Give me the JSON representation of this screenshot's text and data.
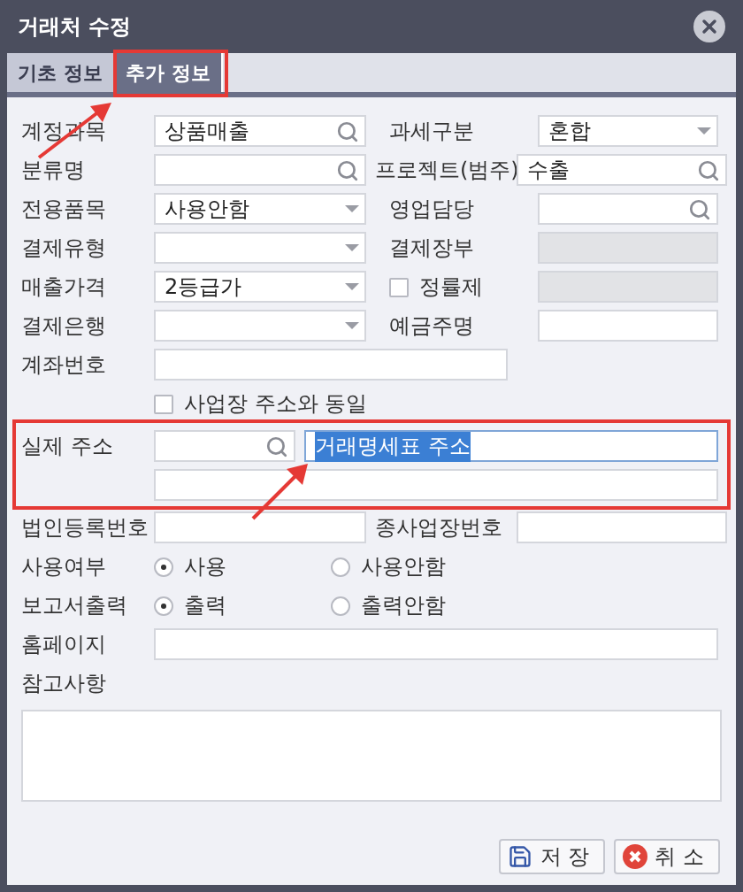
{
  "window": {
    "title": "거래처 수정"
  },
  "tabs": [
    {
      "label": "기초 정보",
      "selected": false
    },
    {
      "label": "추가 정보",
      "selected": true
    }
  ],
  "rows": [
    {
      "kind": "pair",
      "left": {
        "label": "계정과목",
        "field": {
          "kind": "search",
          "value": "상품매출"
        }
      },
      "right": {
        "label": "과세구분",
        "field": {
          "kind": "select",
          "value": "혼합"
        }
      }
    },
    {
      "kind": "pair",
      "left": {
        "label": "분류명",
        "field": {
          "kind": "search"
        }
      },
      "right": {
        "label": "프로젝트(범주)",
        "field": {
          "kind": "search",
          "value": "수출"
        }
      }
    },
    {
      "kind": "pair",
      "left": {
        "label": "전용품목",
        "field": {
          "kind": "select",
          "value": "사용안함"
        }
      },
      "right": {
        "label": "영업담당",
        "field": {
          "kind": "search"
        }
      }
    },
    {
      "kind": "pair",
      "left": {
        "label": "결제유형",
        "field": {
          "kind": "select"
        }
      },
      "right": {
        "label": "결제장부",
        "field": {
          "kind": "readonly"
        }
      }
    },
    {
      "kind": "pair",
      "left": {
        "label": "매출가격",
        "field": {
          "kind": "select",
          "value": "2등급가"
        }
      },
      "right": {
        "check": {
          "label": "정률제",
          "checked": false
        },
        "field": {
          "kind": "readonly"
        }
      }
    },
    {
      "kind": "pair",
      "left": {
        "label": "결제은행",
        "field": {
          "kind": "select"
        }
      },
      "right": {
        "label": "예금주명",
        "field": {
          "kind": "text"
        }
      }
    },
    {
      "kind": "wide",
      "label": "계좌번호",
      "field": {
        "kind": "text"
      }
    },
    {
      "kind": "check",
      "label": "사업장 주소와 동일",
      "checked": false
    },
    {
      "kind": "address",
      "label": "실제 주소",
      "value": "거래명세표 주소",
      "value_selected": true
    },
    {
      "kind": "pair",
      "left": {
        "label": "법인등록번호",
        "field": {
          "kind": "text"
        }
      },
      "right": {
        "label": "종사업장번호",
        "field": {
          "kind": "text"
        }
      }
    },
    {
      "kind": "radio",
      "label": "사용여부",
      "options": [
        {
          "label": "사용",
          "selected": true
        },
        {
          "label": "사용안함",
          "selected": false
        }
      ]
    },
    {
      "kind": "radio",
      "label": "보고서출력",
      "options": [
        {
          "label": "출력",
          "selected": true
        },
        {
          "label": "출력안함",
          "selected": false
        }
      ]
    },
    {
      "kind": "full",
      "label": "홈페이지",
      "field": {
        "kind": "text"
      }
    },
    {
      "kind": "memo",
      "label": "참고사항"
    }
  ],
  "buttons": [
    {
      "kind": "save",
      "label": "저 장"
    },
    {
      "kind": "cancel",
      "label": "취 소"
    }
  ]
}
